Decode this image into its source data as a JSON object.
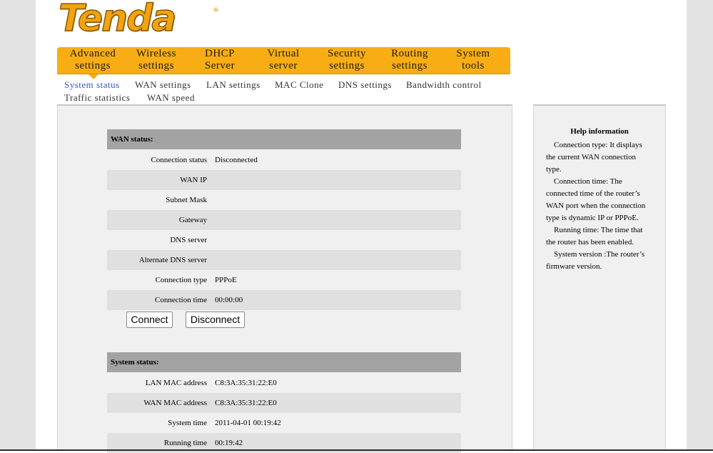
{
  "brand": {
    "logo_text": "Tenda",
    "registered_mark": "®"
  },
  "main_nav": [
    {
      "line1": "Advanced",
      "line2": "settings"
    },
    {
      "line1": "Wireless",
      "line2": "settings"
    },
    {
      "line1": "DHCP",
      "line2": "Server"
    },
    {
      "line1": "Virtual",
      "line2": "server"
    },
    {
      "line1": "Security",
      "line2": "settings"
    },
    {
      "line1": "Routing",
      "line2": "settings"
    },
    {
      "line1": "System",
      "line2": "tools"
    }
  ],
  "sub_nav": [
    "System status",
    "WAN settings",
    "LAN settings",
    "MAC Clone",
    "DNS settings",
    "Bandwidth control",
    "Traffic statistics",
    "WAN speed"
  ],
  "wan_status": {
    "title": "WAN status:",
    "rows": [
      {
        "label": "Connection status",
        "value": "Disconnected"
      },
      {
        "label": "WAN IP",
        "value": ""
      },
      {
        "label": "Subnet Mask",
        "value": ""
      },
      {
        "label": "Gateway",
        "value": ""
      },
      {
        "label": "DNS server",
        "value": ""
      },
      {
        "label": "Alternate DNS server",
        "value": ""
      },
      {
        "label": "Connection type",
        "value": "PPPoE"
      },
      {
        "label": "Connection time",
        "value": "00:00:00"
      }
    ],
    "connect_label": "Connect",
    "disconnect_label": "Disconnect"
  },
  "system_status": {
    "title": "System status:",
    "rows": [
      {
        "label": "LAN MAC address",
        "value": "C8:3A:35:31:22:E0"
      },
      {
        "label": "WAN MAC address",
        "value": "C8:3A:35:31:22:E0"
      },
      {
        "label": "System time",
        "value": "2011-04-01 00:19:42"
      },
      {
        "label": "Running time",
        "value": "00:19:42"
      }
    ]
  },
  "help": {
    "title": "Help information",
    "paragraphs": [
      "Connection type: It displays the current WAN connection type.",
      "Connection time: The connected time of the router’s WAN port when the connection type is dynamic IP or PPPoE.",
      "Running time: The time that the router has been enabled.",
      "System version :The router’s firmware version."
    ]
  },
  "colors": {
    "nav_orange": "#f7ad13",
    "active_link": "#3355cc",
    "header_gray": "#a3a3a3"
  }
}
